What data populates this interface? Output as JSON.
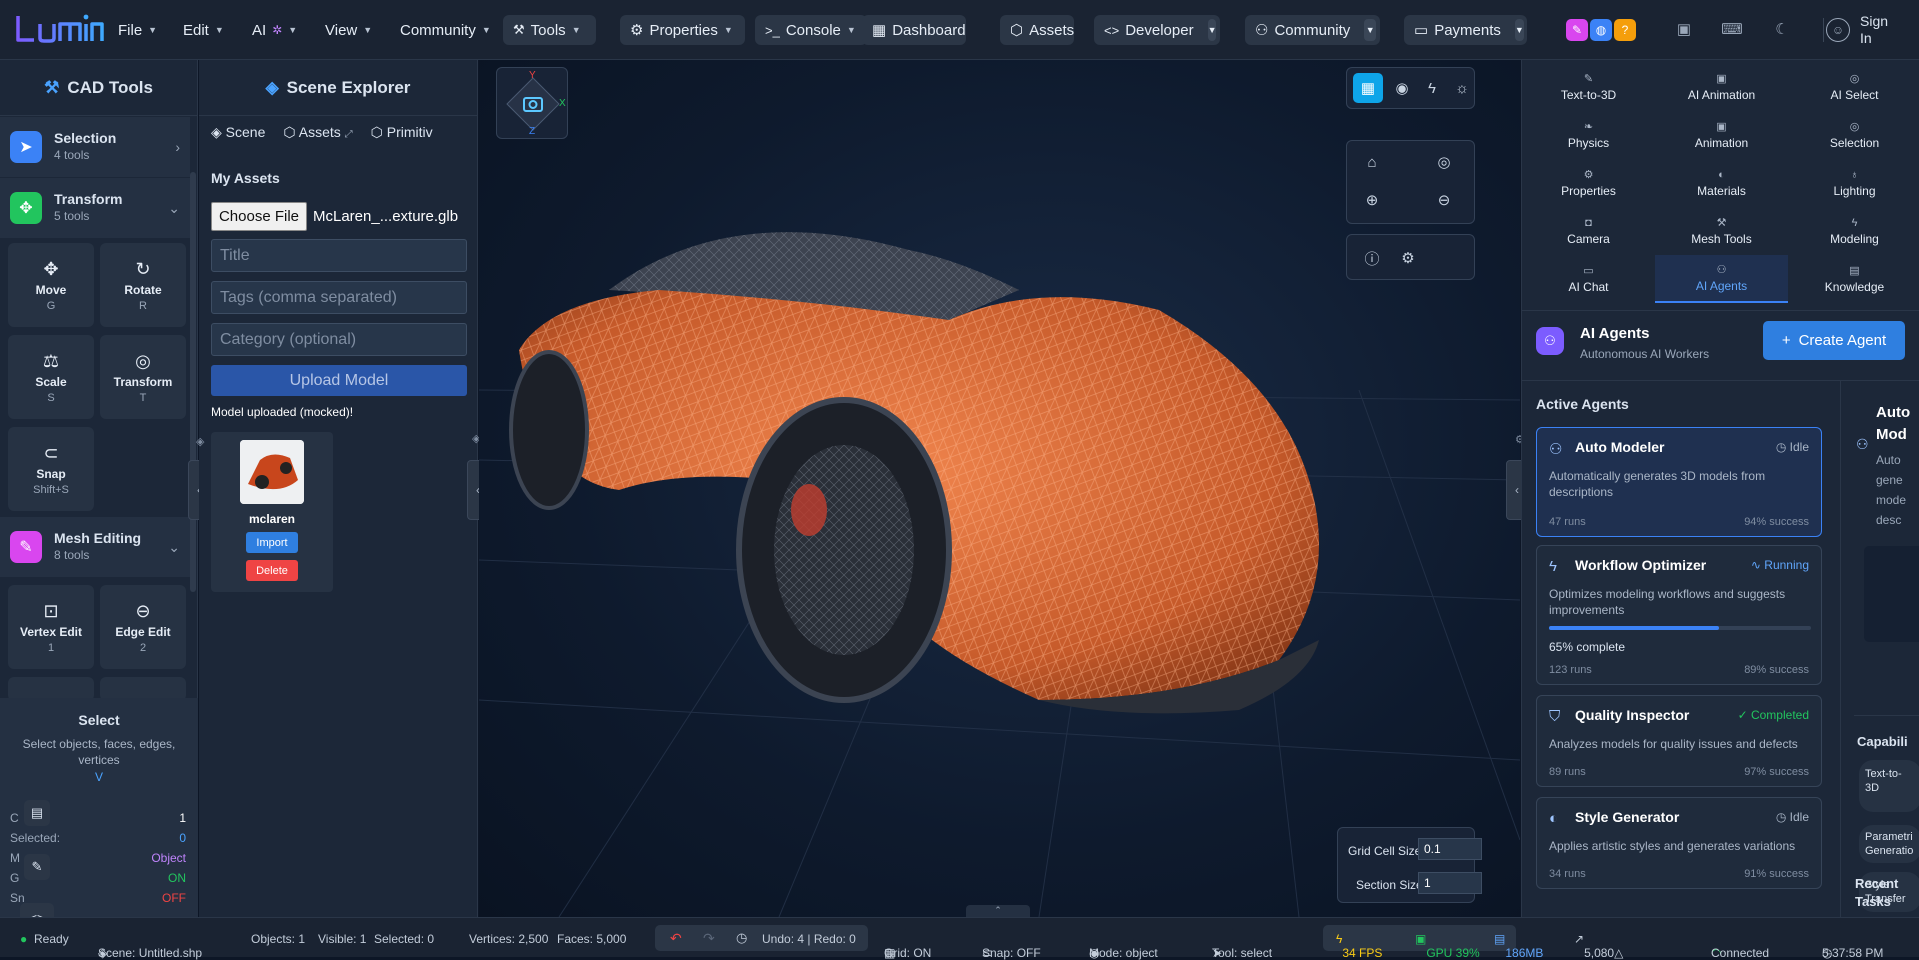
{
  "colors": {
    "accent": "#2f7fe0",
    "success": "#22c55e",
    "danger": "#ef4444",
    "bg": "#0d1626",
    "panel": "#1c2738"
  },
  "topbar": {
    "logo_text": "lumin",
    "menus": [
      "File",
      "Edit",
      "AI",
      "View",
      "Community"
    ],
    "tools_label": "Tools",
    "pills": {
      "properties": "Properties",
      "console": "Console",
      "dashboard": "Dashboard",
      "assets": "Assets",
      "developer": "Developer",
      "community": "Community",
      "payments": "Payments"
    },
    "sign_in": "Sign In"
  },
  "cad": {
    "title": "CAD Tools",
    "groups": [
      {
        "name": "Selection",
        "count": "4 tools"
      },
      {
        "name": "Transform",
        "count": "5 tools"
      },
      {
        "name": "Mesh Editing",
        "count": "8 tools"
      }
    ],
    "tools": [
      {
        "name": "Move",
        "key": "G"
      },
      {
        "name": "Rotate",
        "key": "R"
      },
      {
        "name": "Scale",
        "key": "S"
      },
      {
        "name": "Transform",
        "key": "T"
      },
      {
        "name": "Snap",
        "key": "Shift+S"
      },
      {
        "name": "Vertex Edit",
        "key": "1"
      },
      {
        "name": "Edge Edit",
        "key": "2"
      }
    ],
    "select_card": {
      "title": "Select",
      "desc": "Select objects, faces, edges, vertices",
      "key": "V"
    },
    "stats": [
      {
        "label": "C",
        "value": "1"
      },
      {
        "label": "Selected:",
        "value": "0"
      },
      {
        "label": "M",
        "value": "Object"
      },
      {
        "label": "G",
        "value": "ON"
      },
      {
        "label": "Sn",
        "value": "OFF"
      }
    ]
  },
  "scene": {
    "title": "Scene Explorer",
    "tabs": [
      "Scene",
      "Assets",
      "Primitiv"
    ],
    "section": "My Assets",
    "choose_file": "Choose File",
    "file_name": "McLaren_...exture.glb",
    "title_ph": "Title",
    "tags_ph": "Tags (comma separated)",
    "category_ph": "Category (optional)",
    "upload": "Upload Model",
    "uploaded_msg": "Model uploaded (mocked)!",
    "asset": {
      "name": "mclaren",
      "import": "Import",
      "delete": "Delete"
    }
  },
  "viewport": {
    "axes": {
      "y": "Y",
      "x": "X",
      "z": "Z"
    },
    "grid_cell_label": "Grid Cell Size",
    "grid_cell_value": "0.1",
    "section_label": "Section Size",
    "section_value": "1"
  },
  "right": {
    "tabs": [
      {
        "label": "Text-to-3D",
        "icon": "✎"
      },
      {
        "label": "AI Animation",
        "icon": "▣"
      },
      {
        "label": "AI Select",
        "icon": "◎"
      },
      {
        "label": "Physics",
        "icon": "❧"
      },
      {
        "label": "Animation",
        "icon": "▣"
      },
      {
        "label": "Selection",
        "icon": "◎"
      },
      {
        "label": "Properties",
        "icon": "⚙"
      },
      {
        "label": "Materials",
        "icon": "◐"
      },
      {
        "label": "Lighting",
        "icon": "♁"
      },
      {
        "label": "Camera",
        "icon": "◘"
      },
      {
        "label": "Mesh Tools",
        "icon": "⚒"
      },
      {
        "label": "Modeling",
        "icon": "ϟ"
      },
      {
        "label": "AI Chat",
        "icon": "▭"
      },
      {
        "label": "AI Agents",
        "icon": "⚇"
      },
      {
        "label": "Knowledge",
        "icon": "▤"
      }
    ],
    "agents_title": "AI Agents",
    "agents_sub": "Autonomous AI Workers",
    "create_agent": "Create Agent",
    "active_agents": "Active Agents",
    "agents": [
      {
        "name": "Auto Modeler",
        "status": "Idle",
        "desc": "Automatically generates 3D models from descriptions",
        "runs": "47 runs",
        "success": "94% success"
      },
      {
        "name": "Workflow Optimizer",
        "status": "Running",
        "desc": "Optimizes modeling workflows and suggests improvements",
        "progress_text": "65% complete",
        "progress": 0.65,
        "runs": "123 runs",
        "success": "89% success"
      },
      {
        "name": "Quality Inspector",
        "status": "Completed",
        "desc": "Analyzes models for quality issues and defects",
        "runs": "89 runs",
        "success": "97% success"
      },
      {
        "name": "Style Generator",
        "status": "Idle",
        "desc": "Applies artistic styles and generates variations",
        "runs": "34 runs",
        "success": "91% success"
      }
    ],
    "side": {
      "title": "Auto Mod",
      "desc": "Auto gene mode desc",
      "capab": "Capabili",
      "chips": [
        "Text-to-3D",
        "Parametri Generatio",
        "Style Transfer"
      ],
      "recent": "Recent Tasks"
    }
  },
  "status": {
    "ready": "Ready",
    "scene": "Scene: Untitled.shp",
    "objects": "Objects: 1",
    "visible": "Visible: 1",
    "selected": "Selected: 0",
    "vertices": "Vertices: 2,500",
    "faces": "Faces: 5,000",
    "undo": "Undo: 4 | Redo: 0",
    "grid": "Grid: ON",
    "snap": "Snap: OFF",
    "mode": "Mode: object",
    "tool": "Tool: select",
    "fps": "34 FPS",
    "gpu": "GPU 39%",
    "mem": "186MB",
    "tris": "5,080△",
    "connected": "Connected",
    "time": "5:37:58 PM"
  }
}
